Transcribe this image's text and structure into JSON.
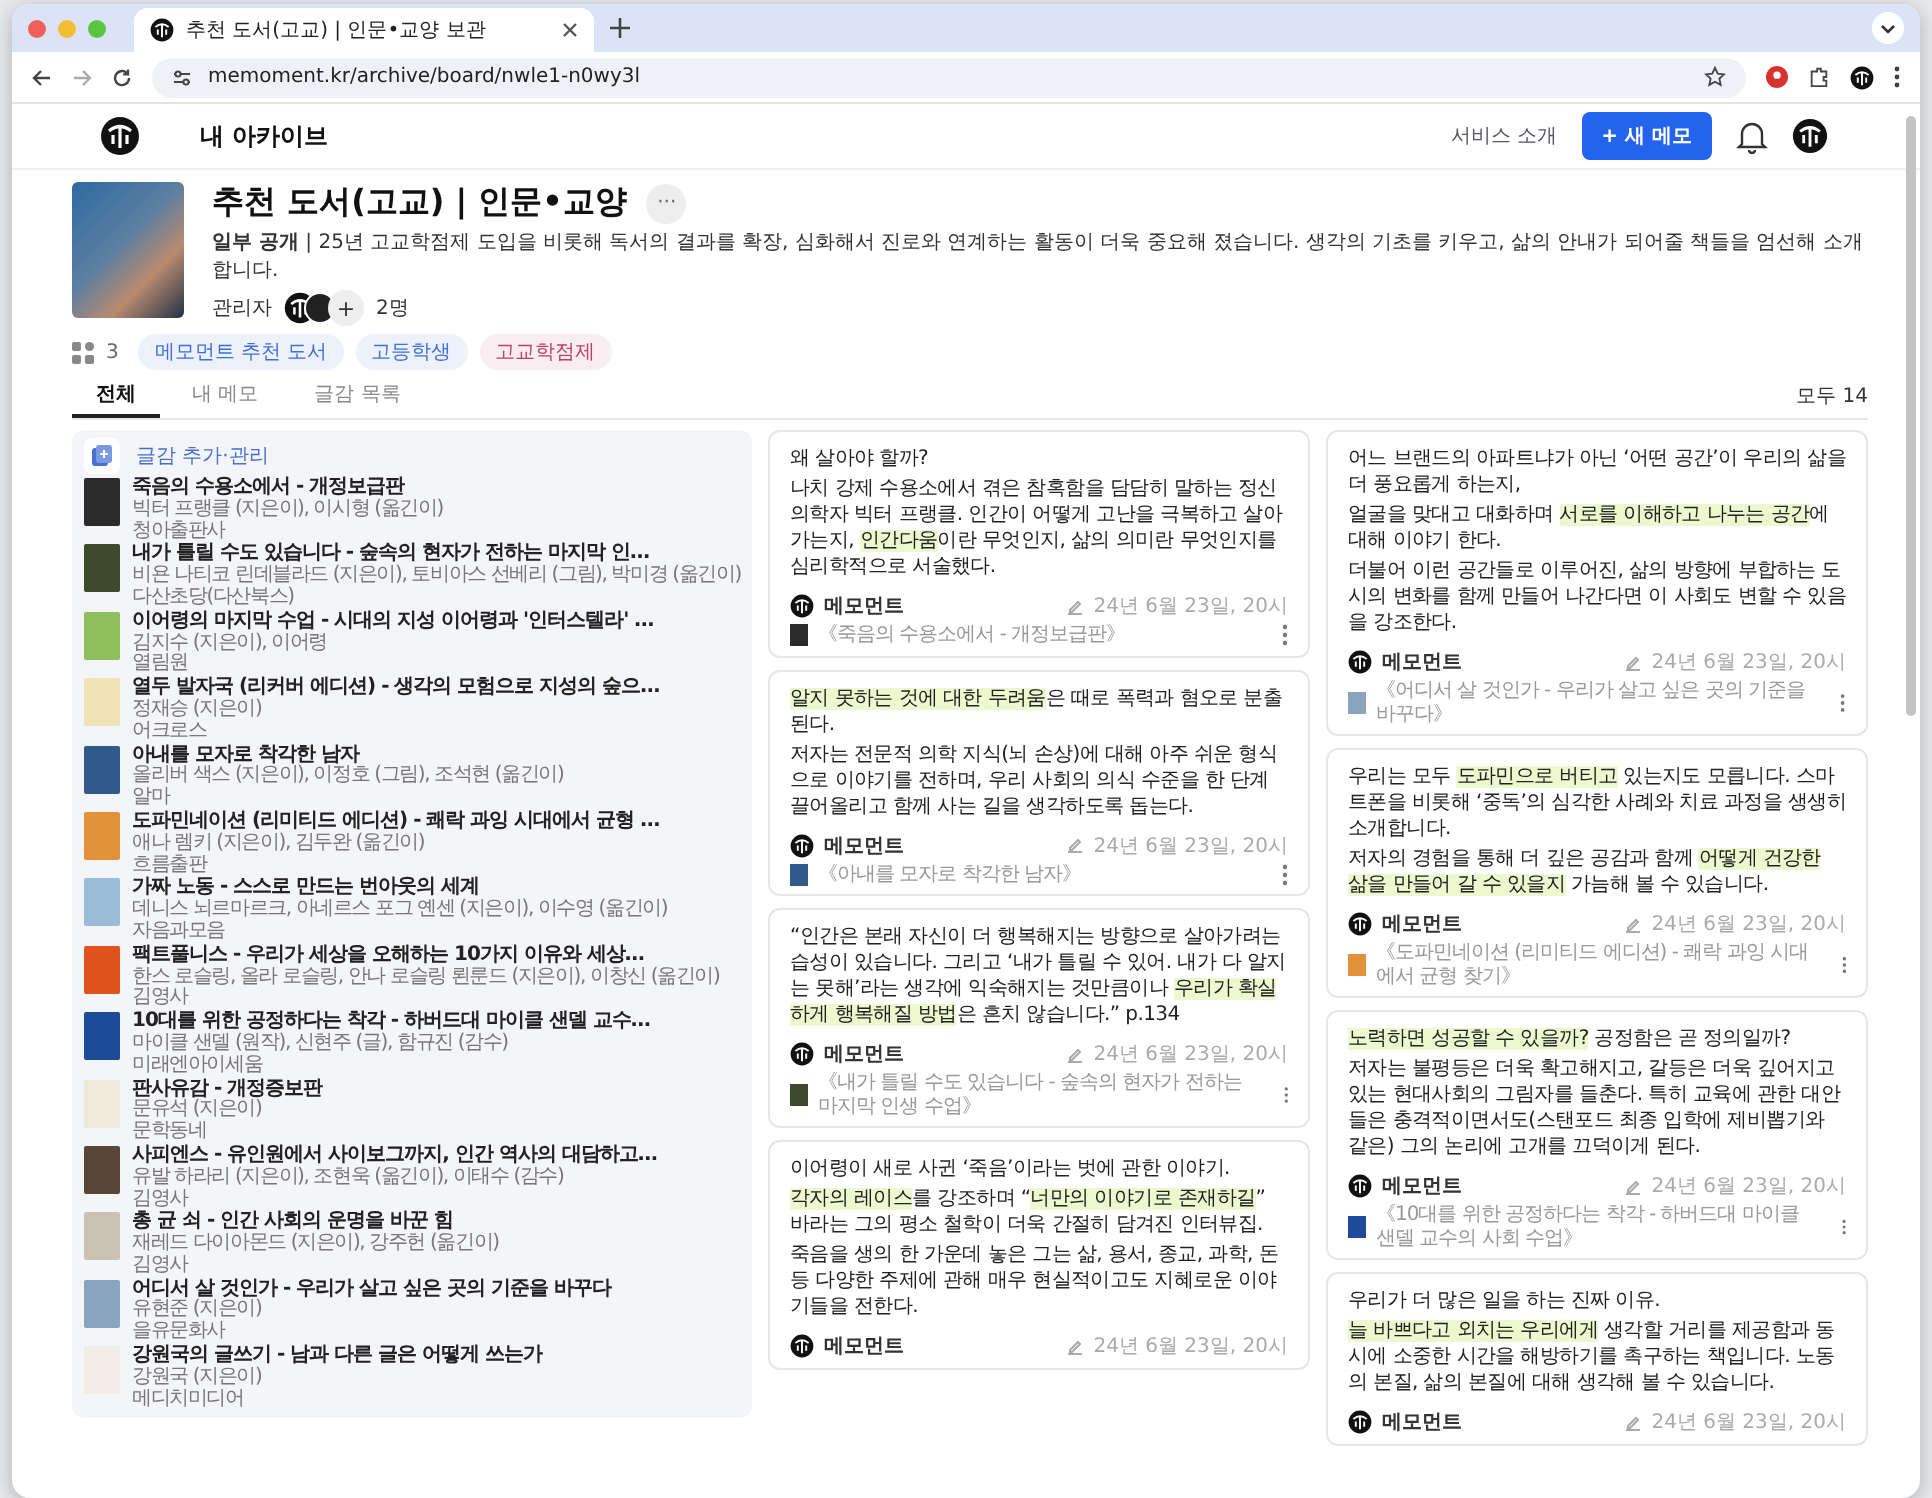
{
  "browser": {
    "tab_title": "추천 도서(고교) | 인문•교양 보관",
    "url": "memoment.kr/archive/board/nwle1-n0wy3l"
  },
  "header": {
    "title": "내 아카이브",
    "link": "서비스 소개",
    "new_button": "+ 새 메모"
  },
  "board": {
    "title": "추천 도서(고교) | 인문•교양",
    "more": "···",
    "description": "**일부 공개** | 25년 고교학점제 도입을 비롯해 독서의 결과를 확장, 심화해서 진로와 연계하는 활동이 더욱 중요해 졌습니다. 생각의 기초를 키우고, 삶의 안내가 되어줄 책들을 엄선해 소개합니다.",
    "manager_label": "관리자",
    "add_manager": "+",
    "manager_count": "2명",
    "tag_count": "3",
    "tags": [
      {
        "label": "메모먼트 추천 도서",
        "color": "#3f6fd8"
      },
      {
        "label": "고등학생",
        "color": "#3f6fd8"
      },
      {
        "label": "고교학점제",
        "color": "#c0406e"
      }
    ]
  },
  "tabs": [
    {
      "label": "전체",
      "selected": true
    },
    {
      "label": "내 메모",
      "selected": false
    },
    {
      "label": "글감 목록",
      "selected": false
    }
  ],
  "total": "모두 14",
  "sidebar": {
    "title": "글감 추가·관리",
    "books": [
      {
        "title": "죽음의 수용소에서 - 개정보급판",
        "authors": "빅터 프랭클 (지은이), 이시형 (옮긴이)",
        "publisher": "청아출판사"
      },
      {
        "title": "내가 틀릴 수도 있습니다 - 숲속의 현자가 전하는 마지막 인…",
        "authors": "비욘 나티코 린데블라드 (지은이), 토비아스 선베리 (그림), 박미경 (옮긴이)",
        "publisher": "다산초당(다산북스)"
      },
      {
        "title": "이어령의 마지막 수업 - 시대의 지성 이어령과 '인터스텔라' …",
        "authors": "김지수 (지은이), 이어령",
        "publisher": "열림원"
      },
      {
        "title": "열두 발자국 (리커버 에디션) - 생각의 모험으로 지성의 숲으…",
        "authors": "정재승 (지은이)",
        "publisher": "어크로스"
      },
      {
        "title": "아내를 모자로 착각한 남자",
        "authors": "올리버 색스 (지은이), 이정호 (그림), 조석현 (옮긴이)",
        "publisher": "알마"
      },
      {
        "title": "도파민네이션 (리미티드 에디션) - 쾌락 과잉 시대에서 균형 …",
        "authors": "애나 렘키 (지은이), 김두완 (옮긴이)",
        "publisher": "흐름출판"
      },
      {
        "title": "가짜 노동 - 스스로 만드는 번아웃의 세계",
        "authors": "데니스 뇌르마르크, 아네르스 포그 옌센 (지은이), 이수영 (옮긴이)",
        "publisher": "자음과모음"
      },
      {
        "title": "팩트풀니스 - 우리가 세상을 오해하는 10가지 이유와 세상…",
        "authors": "한스 로슬링, 올라 로슬링, 안나 로슬링 뢴룬드 (지은이), 이창신 (옮긴이)",
        "publisher": "김영사"
      },
      {
        "title": "10대를 위한 공정하다는 착각 - 하버드대 마이클 샌델 교수…",
        "authors": "마이클 샌델 (원작), 신현주 (글), 함규진 (감수)",
        "publisher": "미래엔아이세움"
      },
      {
        "title": "판사유감 - 개정증보판",
        "authors": "문유석 (지은이)",
        "publisher": "문학동네"
      },
      {
        "title": "사피엔스 - 유인원에서 사이보그까지, 인간 역사의 대담하고…",
        "authors": "유발 하라리 (지은이), 조현욱 (옮긴이), 이태수 (감수)",
        "publisher": "김영사"
      },
      {
        "title": "총 균 쇠 - 인간 사회의 운명을 바꾼 힘",
        "authors": "재레드 다이아몬드 (지은이), 강주헌 (옮긴이)",
        "publisher": "김영사"
      },
      {
        "title": "어디서 살 것인가 - 우리가 살고 싶은 곳의 기준을 바꾸다",
        "authors": "유현준 (지은이)",
        "publisher": "을유문화사"
      },
      {
        "title": "강원국의 글쓰기 - 남과 다른 글은 어떻게 쓰는가",
        "authors": "강원국 (지은이)",
        "publisher": "메디치미디어"
      }
    ]
  },
  "memo_columns": [
    [
      {
        "paragraphs": [
          [
            {
              "text": "왜 살아야 할까?",
              "highlight": false
            }
          ],
          [
            {
              "text": "나치 강제 수용소에서 겪은 참혹함을 담담히 말하는 정신 의학자 빅터 프랭클. 인간이 어떻게 고난을 극복하고 살아가는지, ",
              "highlight": false
            },
            {
              "text": "인간다움",
              "highlight": true
            },
            {
              "text": "이란 무엇인지, 삶의 의미란 무엇인지를 심리학적으로 서술했다.",
              "highlight": false
            }
          ]
        ],
        "author": "메모먼트",
        "date": "24년 6월 23일, 20시",
        "book": "《죽음의 수용소에서 - 개정보급판》"
      },
      {
        "paragraphs": [
          [
            {
              "text": "알지 못하는 것에 대한 두려움",
              "highlight": true
            },
            {
              "text": "은 때로 폭력과 혐오로 분출된다.",
              "highlight": false
            }
          ],
          [
            {
              "text": "저자는 전문적 의학 지식(뇌 손상)에 대해 아주 쉬운 형식으로 이야기를 전하며, 우리 사회의 의식 수준을 한 단계 끌어올리고 함께 사는 길을 생각하도록 돕는다.",
              "highlight": false
            }
          ]
        ],
        "author": "메모먼트",
        "date": "24년 6월 23일, 20시",
        "book": "《아내를 모자로 착각한 남자》"
      },
      {
        "paragraphs": [
          [
            {
              "text": "“인간은 본래 자신이 더 행복해지는 방향으로 살아가려는 습성이 있습니다. 그리고 ‘내가 틀릴 수 있어. 내가 다 알지는 못해’라는 생각에 익숙해지는 것만큼이나 ",
              "highlight": false
            },
            {
              "text": "우리가 확실하게 행복해질 방법",
              "highlight": true
            },
            {
              "text": "은 흔치 않습니다.” p.134",
              "highlight": false
            }
          ]
        ],
        "author": "메모먼트",
        "date": "24년 6월 23일, 20시",
        "book": "《내가 틀릴 수도 있습니다 - 숲속의 현자가 전하는 마지막 인생 수업》"
      },
      {
        "paragraphs": [
          [
            {
              "text": "이어령이 새로 사귄 ‘죽음’이라는 벗에 관한 이야기.",
              "highlight": false
            }
          ],
          [
            {
              "text": "각자의 레이스",
              "highlight": true
            },
            {
              "text": "를 강조하며 “",
              "highlight": false
            },
            {
              "text": "너만의 이야기로 존재하길",
              "highlight": true
            },
            {
              "text": "” 바라는 그의 평소 철학이 더욱 간절히 담겨진 인터뷰집.",
              "highlight": false
            }
          ],
          [
            {
              "text": "죽음을 생의 한 가운데 놓은 그는 삶, 용서, 종교, 과학, 돈 등 다양한 주제에 관해 매우 현실적이고도 지혜로운 이야기들을 전한다.",
              "highlight": false
            }
          ]
        ],
        "author": "메모먼트",
        "date": "24년 6월 23일, 20시"
      }
    ],
    [
      {
        "paragraphs": [
          [
            {
              "text": "어느 브랜드의 아파트냐가 아닌 ‘어떤 공간’이 우리의 삶을 더 풍요롭게 하는지,",
              "highlight": false
            }
          ],
          [
            {
              "text": "얼굴을 맞대고 대화하며 ",
              "highlight": false
            },
            {
              "text": "서로를 이해하고 나누는 공간",
              "highlight": true
            },
            {
              "text": "에 대해 이야기 한다.",
              "highlight": false
            }
          ],
          [
            {
              "text": "더불어 이런 공간들로 이루어진, 삶의 방향에 부합하는 도시의 변화를 함께 만들어 나간다면 이 사회도 변할 수 있음을 강조한다.",
              "highlight": false
            }
          ]
        ],
        "author": "메모먼트",
        "date": "24년 6월 23일, 20시",
        "book": "《어디서 살 것인가 - 우리가 살고 싶은 곳의 기준을 바꾸다》"
      },
      {
        "paragraphs": [
          [
            {
              "text": "우리는 모두 ",
              "highlight": false
            },
            {
              "text": "도파민으로 버티고",
              "highlight": true
            },
            {
              "text": " 있는지도 모릅니다. 스마트폰을 비롯해 ‘중독’의 심각한 사례와 치료 과정을 생생히 소개합니다.",
              "highlight": false
            }
          ],
          [
            {
              "text": "저자의 경험을 통해 더 깊은 공감과 함께 ",
              "highlight": false
            },
            {
              "text": "어떻게 건강한 삶을 만들어 갈 수 있을지",
              "highlight": true
            },
            {
              "text": " 가늠해 볼 수 있습니다.",
              "highlight": false
            }
          ]
        ],
        "author": "메모먼트",
        "date": "24년 6월 23일, 20시",
        "book": "《도파민네이션 (리미티드 에디션) - 쾌락 과잉 시대에서 균형 찾기》"
      },
      {
        "paragraphs": [
          [
            {
              "text": "노력하면 성공할 수 있을까?",
              "highlight": true
            },
            {
              "text": " 공정함은 곧 정의일까?",
              "highlight": false
            }
          ],
          [
            {
              "text": "저자는 불평등은 더욱 확고해지고, 갈등은 더욱 깊어지고 있는 현대사회의 그림자를 들춘다. 특히 교육에 관한 대안들은 충격적이면서도(스탠포드 최종 입학에 제비뽑기와 같은) 그의 논리에 고개를 끄덕이게 된다.",
              "highlight": false
            }
          ]
        ],
        "author": "메모먼트",
        "date": "24년 6월 23일, 20시",
        "book": "《10대를 위한 공정하다는 착각 - 하버드대 마이클 샌델 교수의 사회 수업》"
      },
      {
        "paragraphs": [
          [
            {
              "text": "우리가 더 많은 일을 하는 진짜 이유.",
              "highlight": false
            }
          ],
          [
            {
              "text": "늘 바쁘다고 외치는 우리에게",
              "highlight": true
            },
            {
              "text": " 생각할 거리를 제공함과 동시에 소중한 시간을 해방하기를 촉구하는 책입니다. 노동의 본질, 삶의 본질에 대해 생각해 볼 수 있습니다.",
              "highlight": false
            }
          ]
        ],
        "author": "메모먼트",
        "date": "24년 6월 23일, 20시"
      }
    ]
  ]
}
